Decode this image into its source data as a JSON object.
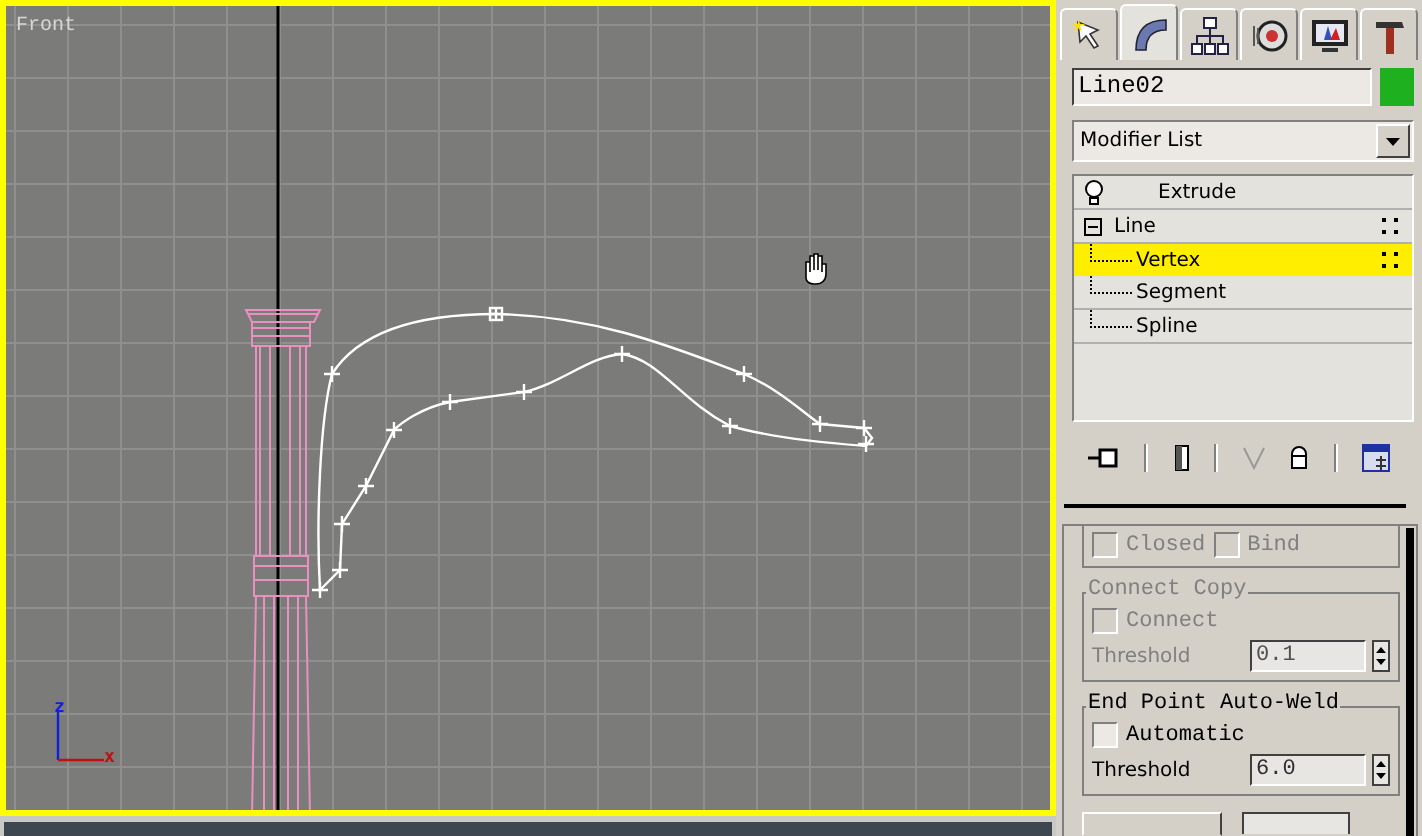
{
  "viewport": {
    "label": "Front",
    "axes": {
      "vertical": "z",
      "horizontal": "x"
    }
  },
  "tabs": [
    {
      "kind": "create",
      "selected": false
    },
    {
      "kind": "modify",
      "selected": true
    },
    {
      "kind": "hierarchy",
      "selected": false
    },
    {
      "kind": "motion",
      "selected": false
    },
    {
      "kind": "display",
      "selected": false
    },
    {
      "kind": "utilities",
      "selected": false
    }
  ],
  "object_name": {
    "value": "Line02",
    "color": "#1fb01f"
  },
  "modifier_list": {
    "label": "Modifier List"
  },
  "stack": [
    {
      "label": "Extrude",
      "kind": "modifier"
    },
    {
      "label": "Line",
      "kind": "object",
      "expanded": true,
      "children": [
        {
          "label": "Vertex",
          "selected": true
        },
        {
          "label": "Segment",
          "selected": false
        },
        {
          "label": "Spline",
          "selected": false
        }
      ]
    }
  ],
  "rollout": {
    "top_checkboxes": [
      {
        "label": "Closed",
        "checked": false,
        "disabled": true
      },
      {
        "label": "Bind",
        "checked": false,
        "disabled": true
      }
    ],
    "groups": [
      {
        "title": "Connect Copy",
        "disabled": true,
        "checkbox": {
          "label": "Connect",
          "checked": false
        },
        "threshold": {
          "label": "Threshold",
          "value": "0.1"
        }
      },
      {
        "title": "End Point Auto-Weld",
        "disabled": false,
        "checkbox": {
          "label": "Automatic",
          "checked": false
        },
        "threshold": {
          "label": "Threshold",
          "value": "6.0"
        }
      }
    ]
  }
}
